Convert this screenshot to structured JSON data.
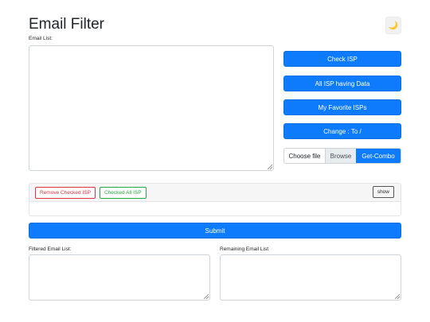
{
  "page": {
    "title": "Email Filter",
    "theme_icon": "moon-icon",
    "theme_glyph": "🌙"
  },
  "email_list": {
    "label": "Email List:",
    "value": ""
  },
  "actions": {
    "check_isp": "Check ISP",
    "all_isp_having_data": "All ISP having Data",
    "my_favorite_isps": "My Favorite ISPs",
    "change_separator": "Change : To /"
  },
  "file_input": {
    "choose_text": "Choose file",
    "browse_label": "Browse",
    "get_combo_label": "Get-Combo"
  },
  "isp_panel": {
    "remove_checked": "Remove Checked ISP",
    "checked_all": "Checked All ISP",
    "show": "show"
  },
  "submit_label": "Submit",
  "filtered": {
    "label": "Filtered Email List:",
    "value": ""
  },
  "remaining": {
    "label": "Remaining Email List",
    "value": ""
  },
  "colors": {
    "primary": "#0d7bfb",
    "danger": "#dc3545",
    "success": "#28a745"
  }
}
